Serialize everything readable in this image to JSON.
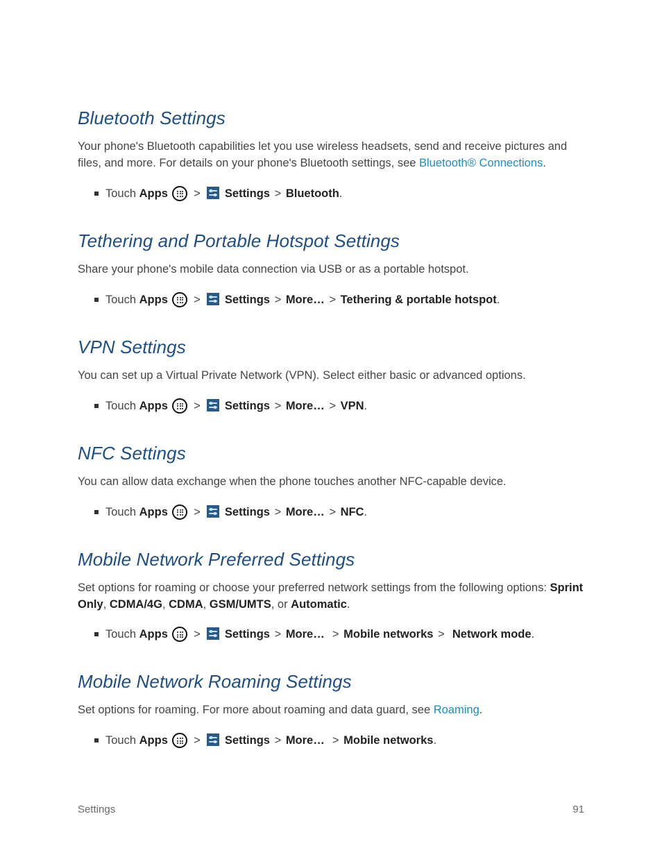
{
  "footer": {
    "left": "Settings",
    "right": "91"
  },
  "common": {
    "touch": "Touch",
    "apps_label": "Apps",
    "settings_label": "Settings",
    "more_label": "More…",
    "gt": ">"
  },
  "sections": {
    "bluetooth": {
      "heading": "Bluetooth Settings",
      "p_a": "Your phone's Bluetooth capabilities let you use wireless headsets, send and receive pictures and files, and more. For details on your phone's Bluetooth settings, see ",
      "link": "Bluetooth® Connections",
      "p_b": ".",
      "tail": "Bluetooth"
    },
    "tethering": {
      "heading": "Tethering and Portable Hotspot Settings",
      "p": "Share your phone's mobile data connection via USB or as a portable hotspot.",
      "tail": "Tethering & portable hotspot"
    },
    "vpn": {
      "heading": "VPN Settings",
      "p": "You can set up a Virtual Private Network (VPN). Select either basic or advanced options.",
      "tail": "VPN"
    },
    "nfc": {
      "heading": "NFC Settings",
      "p": "You can allow data exchange when the phone touches another NFC-capable device.",
      "tail": "NFC"
    },
    "preferred": {
      "heading": "Mobile Network Preferred Settings",
      "p_a": "Set options for roaming or choose your preferred network settings from the following options: ",
      "opt1": "Sprint Only",
      "opt2": "CDMA/4G",
      "opt3": "CDMA",
      "opt4": "GSM/UMTS",
      "or": ", or ",
      "opt5": "Automatic",
      "p_end": ".",
      "mid": "Mobile networks",
      "tail": "Network mode"
    },
    "roaming": {
      "heading": "Mobile Network Roaming Settings",
      "p_a": "Set options for roaming. For more about roaming and data guard, see ",
      "link": "Roaming",
      "p_b": ".",
      "tail": "Mobile networks"
    }
  }
}
